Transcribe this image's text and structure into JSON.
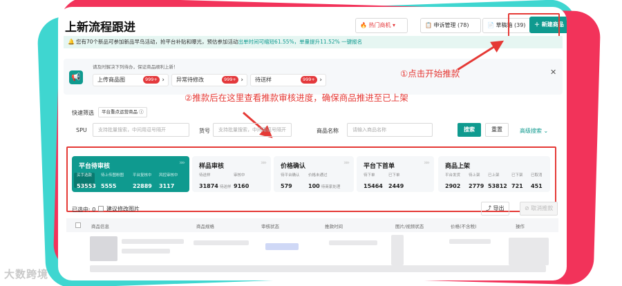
{
  "page": {
    "title": "上新流程跟进",
    "watermark": "大数跨境"
  },
  "header": {
    "hot_label": "🔥 热门商机 ▾",
    "appeal_label": "📋 申诉管理 (78)",
    "draft_label": "📄 草稿箱 (39)",
    "new_label": "＋ 新建商品"
  },
  "notice": {
    "text": "您有70个新品可参加新品早鸟活动，抢平台补贴和曝光，预估参加活动",
    "highlight": "出单时间可缩短61.55%，单量提升11.52%",
    "action": " 一键报名"
  },
  "todo": {
    "tip": "请及时解决下列待办，保证商品顺利上新！",
    "items": [
      {
        "label": "上传商品图",
        "badge": "999+"
      },
      {
        "label": "异常待修改",
        "badge": "999+"
      },
      {
        "label": "待送样",
        "badge": "999+"
      }
    ]
  },
  "annotations": {
    "step1": "①点击开始推款",
    "step2": "②推款后在这里查看推款审核进度，确保商品推进至已上架"
  },
  "filters": {
    "quick_label": "快速筛选",
    "quick_tag": "平台重点运营商品 ⓘ",
    "spu_label": "SPU",
    "spu_placeholder": "支持批量搜索，中间用逗号隔开",
    "sku_label": "货号",
    "sku_placeholder": "支持批量搜索，中间用逗号隔开",
    "name_label": "商品名称",
    "name_placeholder": "请输入商品名称",
    "search": "搜索",
    "reset": "重置",
    "advanced": "高级搜索 ⌄"
  },
  "stats": [
    {
      "name": "平台待审核",
      "metrics": [
        {
          "label": "买手选款",
          "value": "53553"
        },
        {
          "label": "待上传图粉图",
          "value": "5555"
        },
        {
          "label": "平台复核中",
          "value": "22889"
        },
        {
          "label": "风控审核中",
          "value": "3117"
        }
      ]
    },
    {
      "name": "样品审核",
      "metrics": [
        {
          "label": "待送样",
          "value": "31874",
          "sub": "待送样"
        },
        {
          "label": "审核中",
          "value": "9160"
        }
      ]
    },
    {
      "name": "价格确认",
      "metrics": [
        {
          "label": "待平台确认",
          "value": "579"
        },
        {
          "label": "价格未通过",
          "value": "100",
          "sub": "待商家处理"
        }
      ]
    },
    {
      "name": "平台下首单",
      "metrics": [
        {
          "label": "待下单",
          "value": "15464"
        },
        {
          "label": "已下单",
          "value": "2449"
        }
      ]
    },
    {
      "name": "商品上架",
      "metrics": [
        {
          "label": "平台发货",
          "value": "2902"
        },
        {
          "label": "待上架",
          "value": "2779"
        },
        {
          "label": "已上架",
          "value": "53812"
        },
        {
          "label": "已下架",
          "value": "721"
        },
        {
          "label": "已取消",
          "value": "451"
        }
      ]
    }
  ],
  "selection": {
    "selected_label": "已选中: 0",
    "suggest_label": "建议修改图片",
    "export": "⤴ 导出",
    "cancel": "⊘ 取消推款"
  },
  "table": {
    "headers": [
      "商品信息",
      "商品规格",
      "审核状态",
      "推款时间",
      "图片/视频状态",
      "价格(不含税)",
      "操作"
    ]
  },
  "colors": {
    "brand": "#0f9a8f",
    "annotation": "#e53935",
    "badge": "#e4393c"
  }
}
